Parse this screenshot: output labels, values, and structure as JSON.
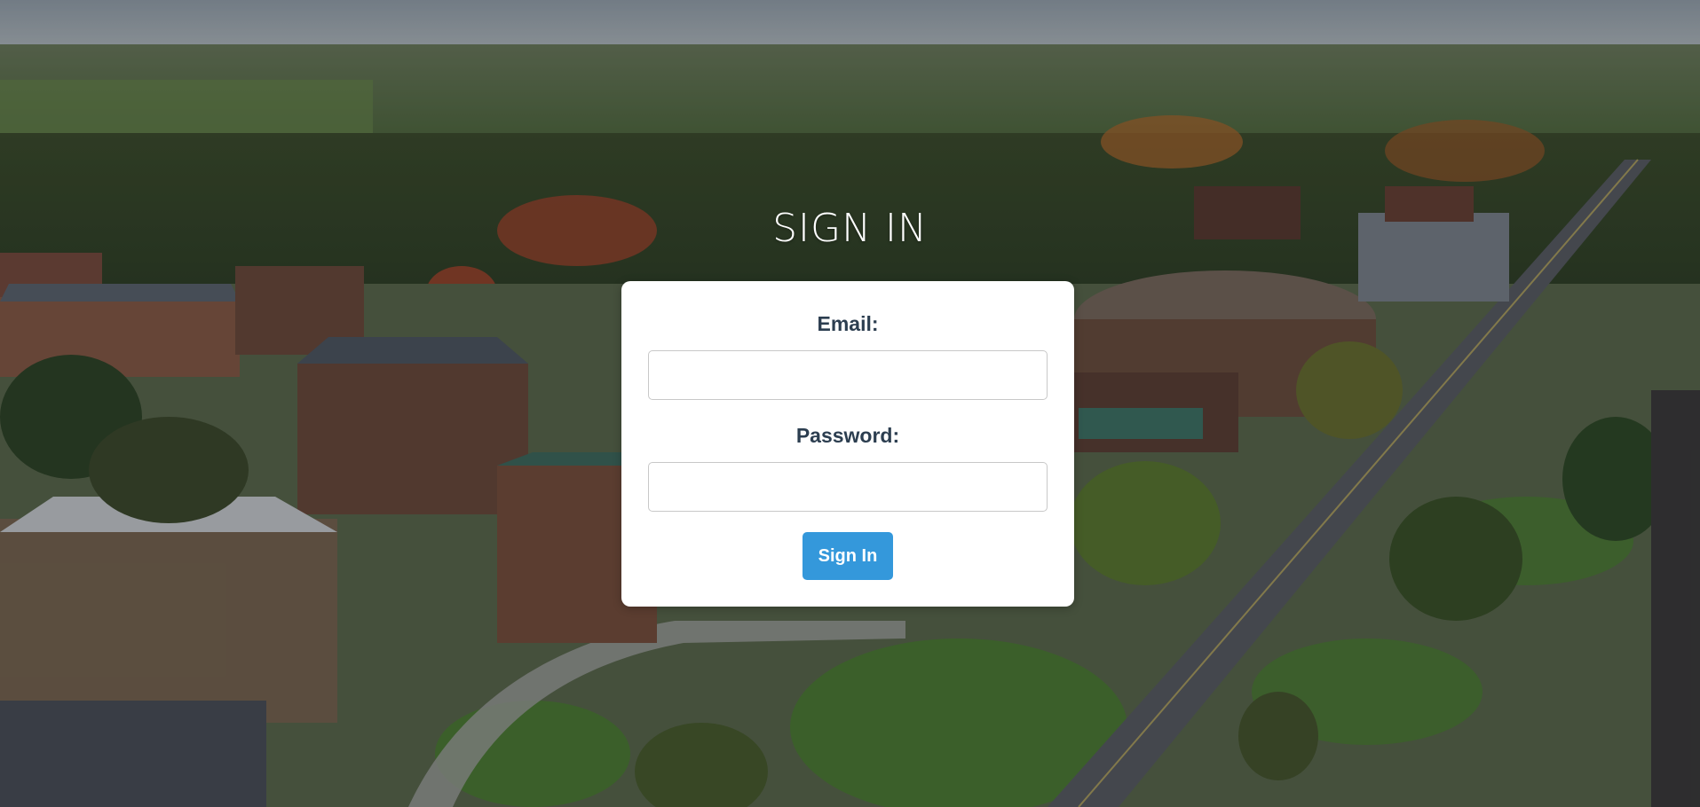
{
  "page": {
    "title": "SIGN IN"
  },
  "form": {
    "email_label": "Email:",
    "email_value": "",
    "email_placeholder": "",
    "password_label": "Password:",
    "password_value": "",
    "password_placeholder": "",
    "submit_label": "Sign In"
  },
  "colors": {
    "card_background": "#ffffff",
    "label_text": "#2c3e50",
    "button_background": "#3498db",
    "button_text": "#ffffff",
    "title_text": "#ffffff"
  },
  "background": {
    "image_subject": "aerial-campus-photo"
  }
}
